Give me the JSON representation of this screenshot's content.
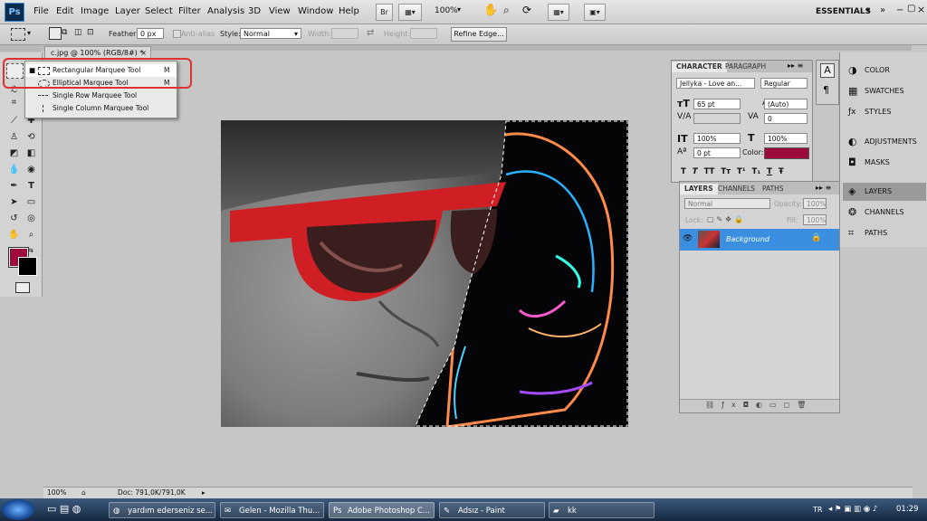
{
  "app": {
    "logo": "Ps"
  },
  "menu": [
    "File",
    "Edit",
    "Image",
    "Layer",
    "Select",
    "Filter",
    "Analysis",
    "3D",
    "View",
    "Window",
    "Help"
  ],
  "appbar": {
    "br_label": "Br",
    "zoom": "100%",
    "workspace": "ESSENTIALS"
  },
  "options": {
    "feather_label": "Feather:",
    "feather_value": "0 px",
    "antialias_label": "Anti-alias",
    "style_label": "Style:",
    "style_value": "Normal",
    "width_label": "Width:",
    "height_label": "Height:",
    "refine_edge": "Refine Edge..."
  },
  "document": {
    "tab_title": "c.jpg @ 100% (RGB/8#) *",
    "close_glyph": "×"
  },
  "tool_flyout": {
    "items": [
      {
        "label": "Rectangular Marquee Tool",
        "shortcut": "M"
      },
      {
        "label": "Elliptical Marquee Tool",
        "shortcut": "M"
      },
      {
        "label": "Single Row Marquee Tool",
        "shortcut": ""
      },
      {
        "label": "Single Column Marquee Tool",
        "shortcut": ""
      }
    ]
  },
  "colors": {
    "foreground": "#9e0b3a",
    "background": "#000000",
    "color_swatch": "#9e0b3a"
  },
  "character_panel": {
    "tabs": [
      "CHARACTER",
      "PARAGRAPH"
    ],
    "font_family": "Jellyka - Love an...",
    "font_style": "Regular",
    "size": "65 pt",
    "leading": "(Auto)",
    "tracking": "0",
    "vscale": "100%",
    "hscale": "100%",
    "baseline": "0 pt",
    "color_label": "Color:",
    "style_buttons": [
      "T",
      "T",
      "TT",
      "Tт",
      "T¹",
      "T₁",
      "T",
      "Ŧ"
    ]
  },
  "layers_panel": {
    "tabs": [
      "LAYERS",
      "CHANNELS",
      "PATHS"
    ],
    "blend_mode": "Normal",
    "opacity_label": "Opacity:",
    "opacity": "100%",
    "lock_label": "Lock:",
    "fill_label": "Fill:",
    "fill": "100%",
    "layer_name": "Background"
  },
  "dock": [
    "COLOR",
    "SWATCHES",
    "STYLES",
    "ADJUSTMENTS",
    "MASKS",
    "LAYERS",
    "CHANNELS",
    "PATHS"
  ],
  "status": {
    "zoom": "100%",
    "doc_info": "Doc: 791,0K/791,0K"
  },
  "taskbar": {
    "items": [
      "yardım ederseniz se...",
      "Gelen - Mozilla Thu...",
      "Adobe Photoshop C...",
      "Adsız - Paint",
      "kk"
    ],
    "language": "TR",
    "time": "01:29"
  }
}
